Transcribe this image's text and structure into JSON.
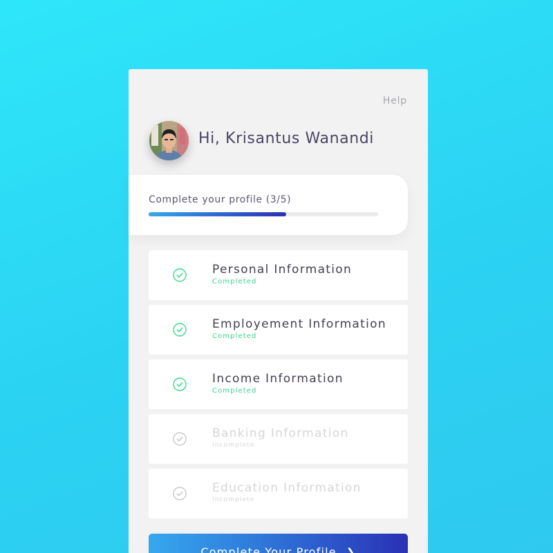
{
  "header": {
    "help_label": "Help",
    "greeting": "Hi, Krisantus Wanandi",
    "avatar_icon": "user-photo"
  },
  "progress": {
    "label": "Complete your profile (3/5)",
    "completed": 3,
    "total": 5,
    "fraction": 0.6
  },
  "steps": [
    {
      "title": "Personal Information",
      "status": "Completed",
      "done": true
    },
    {
      "title": "Employement Information",
      "status": "Completed",
      "done": true
    },
    {
      "title": "Income Information",
      "status": "Completed",
      "done": true
    },
    {
      "title": "Banking Information",
      "status": "Incomplete",
      "done": false
    },
    {
      "title": "Education Information",
      "status": "Incomplete",
      "done": false
    }
  ],
  "cta": {
    "label": "Complete Your Profile",
    "icon": "chevron-right-icon"
  },
  "colors": {
    "background": "#2ee6fa",
    "completed": "#37d98a",
    "incomplete": "#d6d6da",
    "accent_start": "#36a8ee",
    "accent_end": "#2a30b4"
  }
}
